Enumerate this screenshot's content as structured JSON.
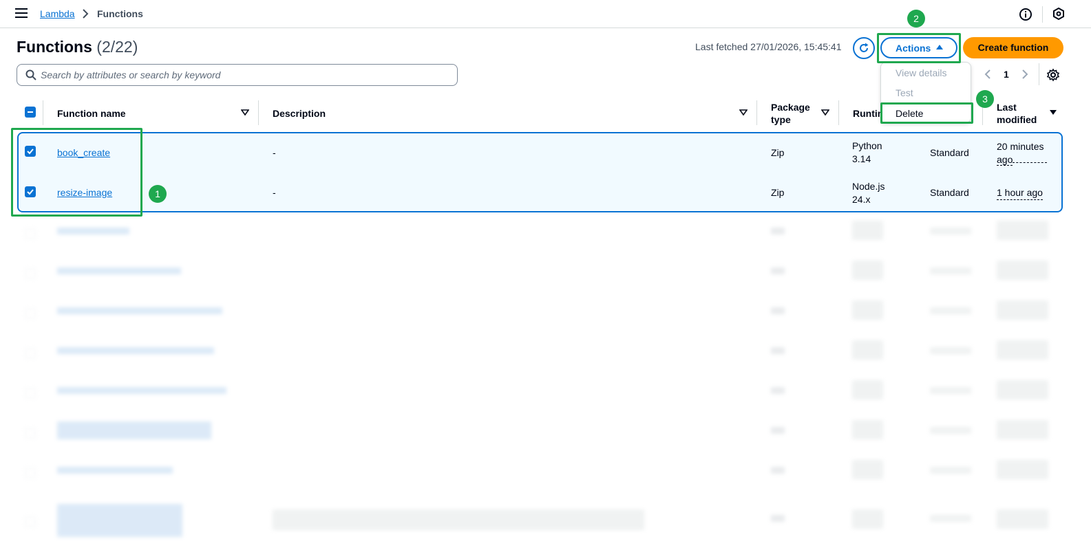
{
  "breadcrumb": {
    "root": "Lambda",
    "current": "Functions"
  },
  "header": {
    "title": "Functions",
    "count": "(2/22)",
    "last_fetched": "Last fetched 27/01/2026, 15:45:41",
    "actions_label": "Actions",
    "create_label": "Create function"
  },
  "actions_menu": {
    "view_details": "View details",
    "test": "Test",
    "delete": "Delete"
  },
  "search": {
    "placeholder": "Search by attributes or search by keyword"
  },
  "pagination": {
    "page": "1"
  },
  "columns": {
    "function_name": "Function name",
    "description": "Description",
    "package_type_1": "Package",
    "package_type_2": "type",
    "runtime": "Runtime",
    "last_modified_1": "Last",
    "last_modified_2": "modified"
  },
  "rows": [
    {
      "name": "book_create",
      "description": "-",
      "package": "Zip",
      "runtime_1": "Python",
      "runtime_2": "3.14",
      "arch": "Standard",
      "modified_1": "20 minutes",
      "modified_2": "ago"
    },
    {
      "name": "resize-image",
      "description": "-",
      "package": "Zip",
      "runtime_1": "Node.js",
      "runtime_2": "24.x",
      "arch": "Standard",
      "modified_1": "1 hour ago"
    }
  ],
  "annotations": {
    "step1": "1",
    "step2": "2",
    "step3": "3"
  },
  "colors": {
    "accent": "#0972d3",
    "primary_button": "#ff9900",
    "annotation": "#1fa84f",
    "selected_row": "#f1faff"
  }
}
